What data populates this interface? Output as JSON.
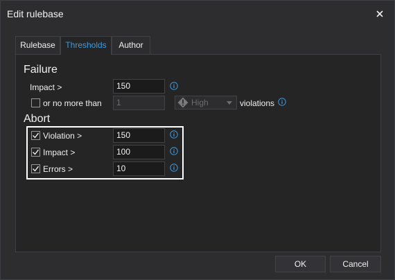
{
  "window": {
    "title": "Edit rulebase"
  },
  "tabs": [
    {
      "label": "Rulebase"
    },
    {
      "label": "Thresholds"
    },
    {
      "label": "Author"
    }
  ],
  "failure": {
    "heading": "Failure",
    "impact": {
      "label": "Impact >",
      "value": "150"
    },
    "no_more_than": {
      "label": "or no more than",
      "checked": false,
      "value": "1",
      "severity": "High",
      "suffix": "violations"
    }
  },
  "abort": {
    "heading": "Abort",
    "violation": {
      "label": "Violation >",
      "checked": true,
      "value": "150"
    },
    "impact": {
      "label": "Impact >",
      "checked": true,
      "value": "100"
    },
    "errors": {
      "label": "Errors >",
      "checked": true,
      "value": "10"
    }
  },
  "footer": {
    "ok_label": "OK",
    "cancel_label": "Cancel"
  },
  "colors": {
    "accent": "#3e9be0",
    "background": "#2d2d30",
    "panel": "#252526",
    "input": "#1b1b1c"
  }
}
